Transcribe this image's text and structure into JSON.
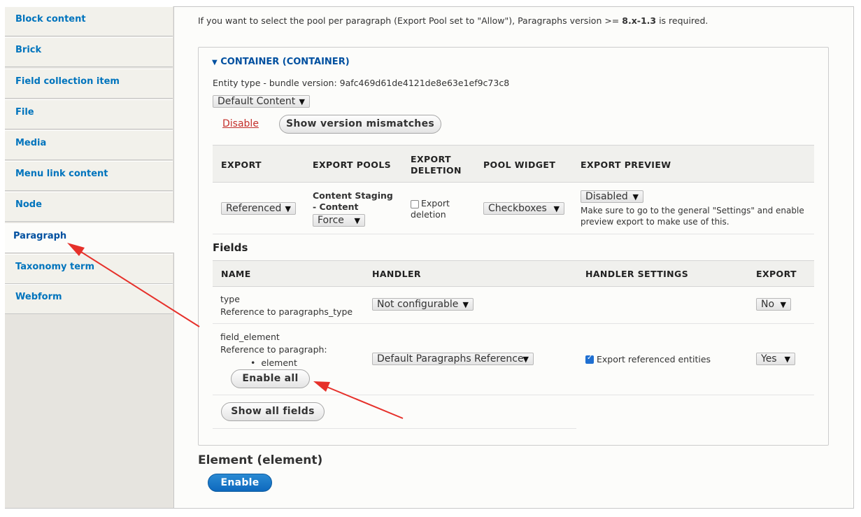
{
  "sidebar": {
    "items": [
      {
        "label": "Block content"
      },
      {
        "label": "Brick"
      },
      {
        "label": "Field collection item"
      },
      {
        "label": "File"
      },
      {
        "label": "Media"
      },
      {
        "label": "Menu link content"
      },
      {
        "label": "Node"
      },
      {
        "label": "Paragraph",
        "active": true
      },
      {
        "label": "Taxonomy term"
      },
      {
        "label": "Webform"
      }
    ]
  },
  "intro": {
    "text": "If you want to select the pool per paragraph (Export Pool set to \"Allow\"), Paragraphs version >= ",
    "version": "8.x-1.3",
    "suffix": " is required."
  },
  "container": {
    "summary": "CONTAINER (CONTAINER)",
    "summary_icon": "triangle-down-icon",
    "entity_type_label": "Entity type - bundle version: 9afc469d61de4121de8e63e1ef9c73c8",
    "content_select": "Default Content",
    "disable_link": "Disable",
    "mismatch_button": "Show version mismatches",
    "export_table": {
      "headers": [
        "EXPORT",
        "EXPORT POOLS",
        "EXPORT\nDELETION",
        "POOL WIDGET",
        "EXPORT PREVIEW"
      ],
      "headers_lines": [
        [
          "EXPORT"
        ],
        [
          "EXPORT POOLS"
        ],
        [
          "EXPORT",
          "DELETION"
        ],
        [
          "POOL WIDGET"
        ],
        [
          "EXPORT PREVIEW"
        ]
      ],
      "export_select": "Referenced",
      "pool_name_1": "Content Staging",
      "pool_name_2": "- Content",
      "pool_select": "Force",
      "deletion_label_1": "Export",
      "deletion_label_2": "deletion",
      "deletion_checked": false,
      "widget_select": "Checkboxes",
      "preview_select": "Disabled",
      "preview_help_1": "Make sure to go to the general \"Settings\" and enable",
      "preview_help_2": "preview export to make use of this."
    },
    "fields_heading": "Fields",
    "fields_table": {
      "headers": [
        "NAME",
        "HANDLER",
        "HANDLER SETTINGS",
        "EXPORT"
      ],
      "rows": [
        {
          "name": "type",
          "desc": "Reference to paragraphs_type",
          "handler": "Not configurable",
          "export": "No"
        },
        {
          "name": "field_element",
          "desc": "Reference to paragraph:",
          "bullet": "element",
          "handler": "Default Paragraphs Reference",
          "setting": "Export referenced entities",
          "setting_checked": true,
          "export": "Yes",
          "button": "Enable all"
        }
      ]
    },
    "show_all_button": "Show all fields"
  },
  "element": {
    "heading": "Element (element)",
    "enable_button": "Enable"
  },
  "colors": {
    "link": "#0074bd",
    "primary": "#0e69be",
    "annotation": "#e6302a",
    "danger": "#c4302b"
  }
}
